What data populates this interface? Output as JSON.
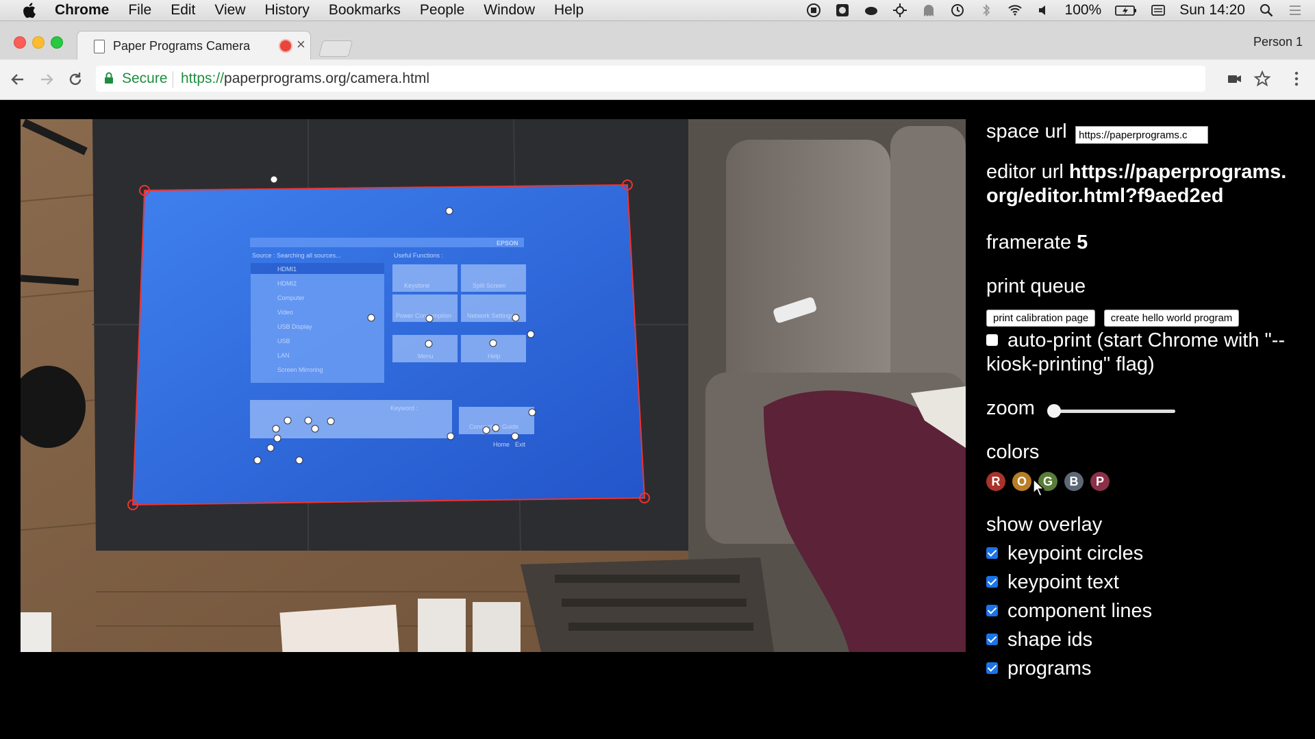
{
  "menubar": {
    "app_name": "Chrome",
    "items": [
      "File",
      "Edit",
      "View",
      "History",
      "Bookmarks",
      "People",
      "Window",
      "Help"
    ],
    "battery": "100%",
    "clock": "Sun 14:20"
  },
  "tab": {
    "title": "Paper Programs Camera",
    "profile": "Person 1"
  },
  "toolbar": {
    "secure_label": "Secure",
    "url_scheme": "https://",
    "url_rest": "paperprograms.org/camera.html"
  },
  "panel": {
    "space_url": {
      "label": "space url",
      "value": "https://paperprograms.c"
    },
    "editor_url": {
      "label": "editor url",
      "value": "https://paperprograms.org/editor.html?f9aed2ed"
    },
    "framerate": {
      "label": "framerate",
      "value": "5"
    },
    "print_queue": {
      "label": "print queue",
      "buttons": [
        "print calibration page",
        "create hello world program"
      ],
      "auto_print_label": "auto-print (start Chrome with \"--kiosk-printing\" flag)",
      "auto_print_checked": false
    },
    "zoom": {
      "label": "zoom",
      "value": 0
    },
    "colors": {
      "label": "colors",
      "swatches": [
        {
          "letter": "R",
          "color": "#a8332a"
        },
        {
          "letter": "O",
          "color": "#b87d26"
        },
        {
          "letter": "G",
          "color": "#5a7c3a"
        },
        {
          "letter": "B",
          "color": "#5d6874"
        },
        {
          "letter": "P",
          "color": "#8a3049"
        }
      ]
    },
    "overlay": {
      "label": "show overlay",
      "options": [
        {
          "label": "keypoint circles",
          "checked": true
        },
        {
          "label": "keypoint text",
          "checked": true
        },
        {
          "label": "component lines",
          "checked": true
        },
        {
          "label": "shape ids",
          "checked": true
        },
        {
          "label": "programs",
          "checked": true
        }
      ]
    }
  },
  "camera": {
    "projected_brand": "EPSON",
    "projected_headers": [
      "Source : Searching all sources...",
      "Useful Functions :"
    ],
    "projected_sources": [
      "HDMI1",
      "HDMI2",
      "Computer",
      "Video",
      "USB Display",
      "USB",
      "LAN",
      "Screen Mirroring"
    ],
    "projected_functions": [
      "Keystone",
      "Split Screen",
      "Power Consumption",
      "Network Settings",
      "Menu",
      "Help"
    ],
    "projected_footer": [
      "Keyword :",
      "Connection Guide",
      "Home",
      "Exit"
    ]
  }
}
